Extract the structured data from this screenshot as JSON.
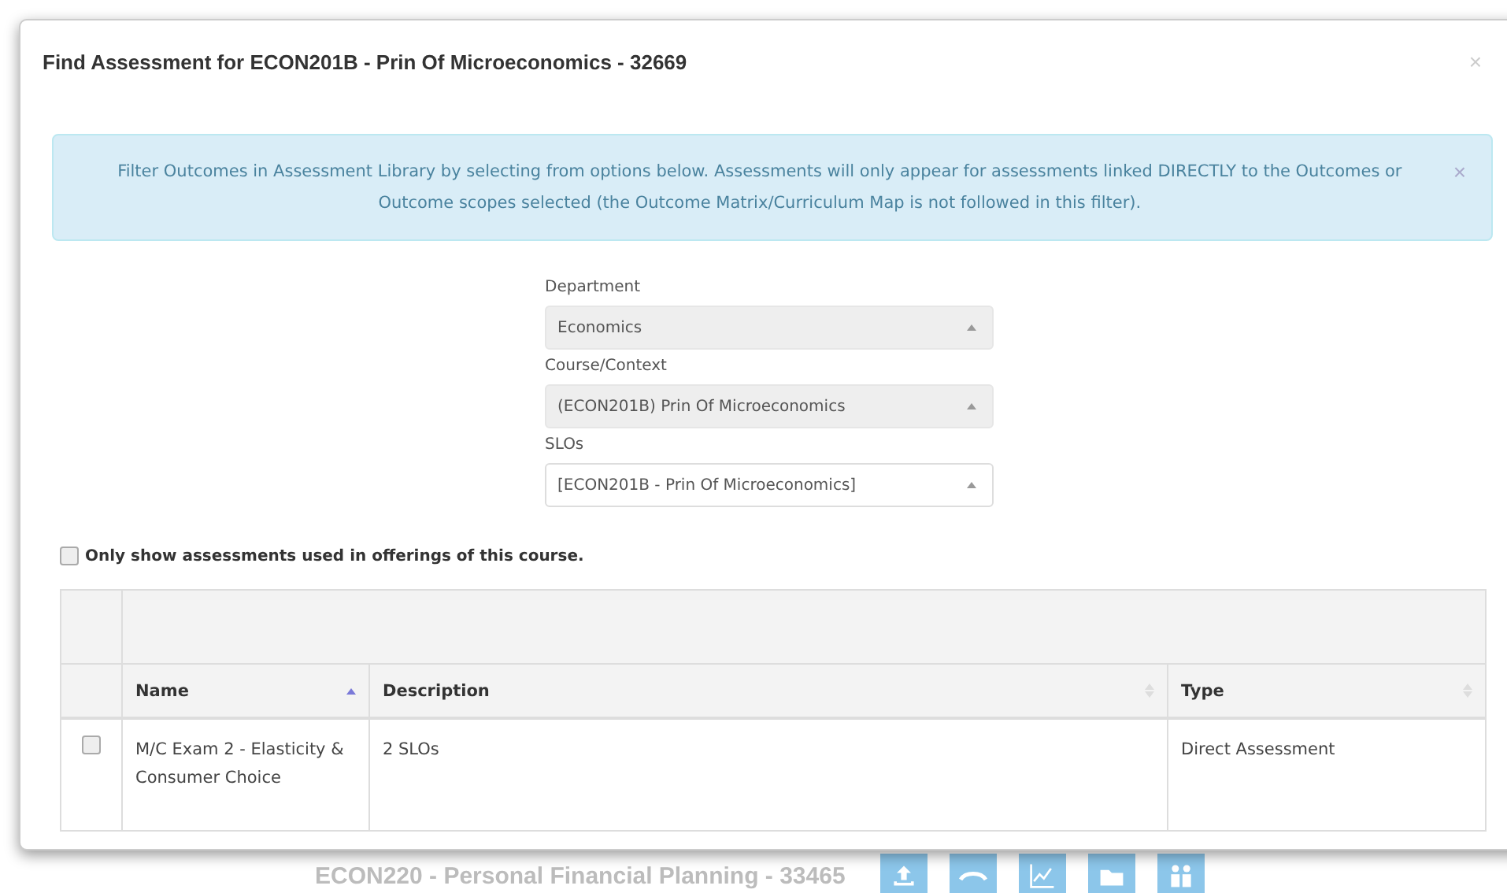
{
  "background": {
    "course_title": "ECON220 - Personal Financial Planning - 33465",
    "actions": [
      {
        "kind": "upload"
      },
      {
        "kind": "link"
      },
      {
        "kind": "chart"
      },
      {
        "kind": "folder"
      },
      {
        "kind": "people"
      }
    ]
  },
  "modal": {
    "title": "Find Assessment for ECON201B - Prin Of Microeconomics - 32669",
    "close": "×",
    "alert": {
      "text": "Filter Outcomes in Assessment Library by selecting from options below. Assessments will only appear for assessments linked DIRECTLY to the Outcomes or Outcome scopes selected (the Outcome Matrix/Curriculum Map is not followed in this filter).",
      "close": "×"
    },
    "filters": [
      {
        "label": "Department",
        "value": "Economics",
        "disabled": true
      },
      {
        "label": "Course/Context",
        "value": "(ECON201B) Prin Of Microeconomics",
        "disabled": true
      },
      {
        "label": "SLOs",
        "value": "[ECON201B - Prin Of Microeconomics]",
        "disabled": false
      }
    ],
    "only_offerings": {
      "label": "Only show assessments used in offerings of this course.",
      "checked": false
    },
    "table": {
      "columns": [
        {
          "label": "Name",
          "sorted_ascending": true
        },
        {
          "label": "Description",
          "sorted_ascending": false
        },
        {
          "label": "Type",
          "sorted_ascending": false
        }
      ],
      "rows": [
        {
          "checked": false,
          "cells": [
            "M/C Exam 2 - Elasticity & Consumer Choice",
            "2 SLOs",
            "Direct Assessment"
          ]
        }
      ]
    }
  }
}
